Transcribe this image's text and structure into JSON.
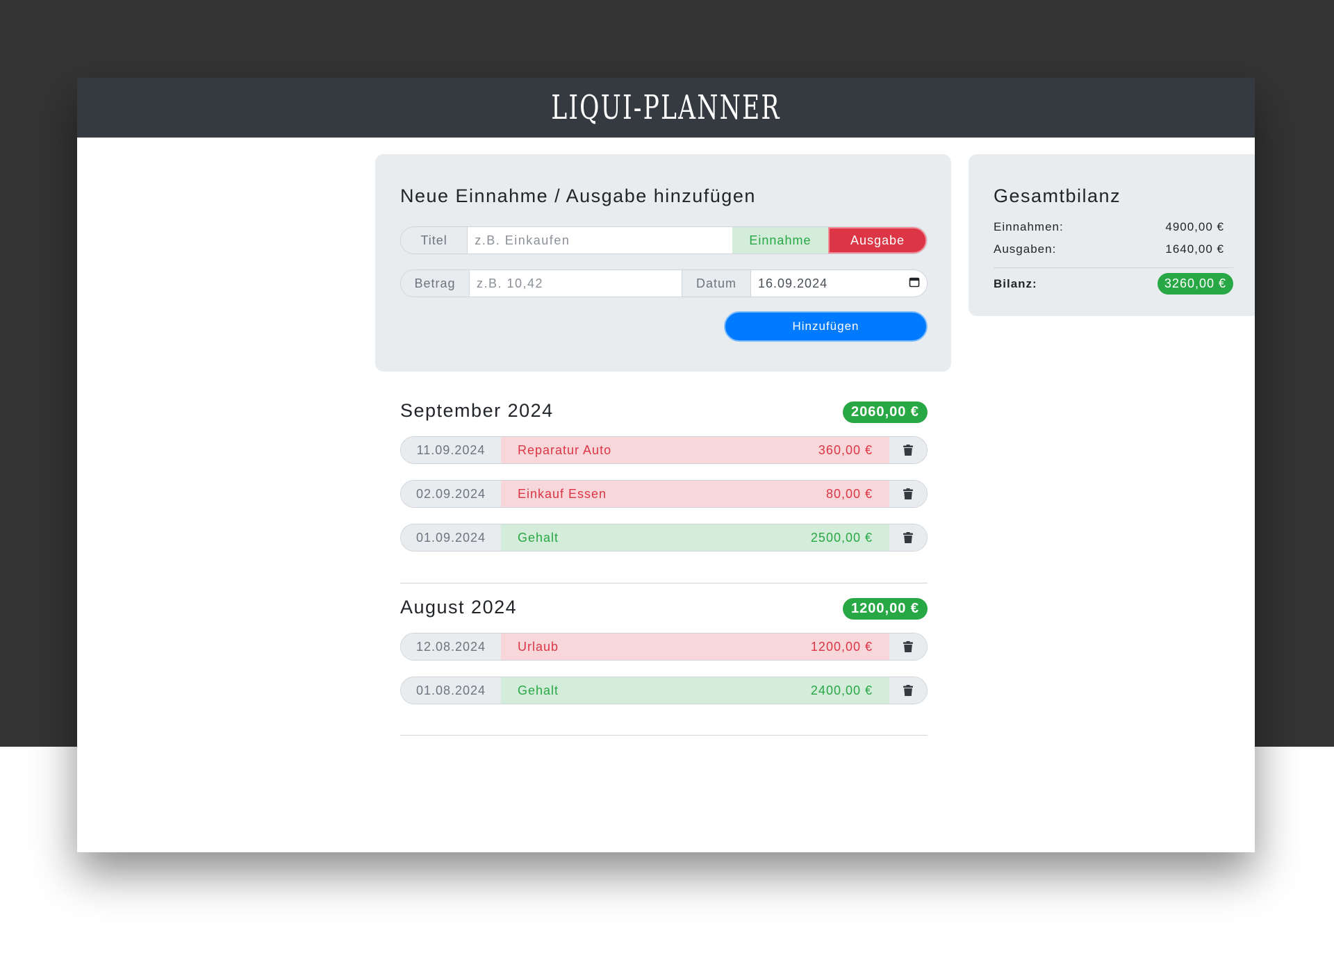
{
  "header": {
    "title": "LIQUI-PLANNER"
  },
  "form": {
    "heading": "Neue Einnahme / Ausgabe hinzufügen",
    "title_label": "Titel",
    "title_placeholder": "z.B. Einkaufen",
    "type_income": "Einnahme",
    "type_expense": "Ausgabe",
    "amount_label": "Betrag",
    "amount_placeholder": "z.B. 10,42",
    "date_label": "Datum",
    "date_value": "16.09.2024",
    "submit_label": "Hinzufügen"
  },
  "balance": {
    "heading": "Gesamtbilanz",
    "income_label": "Einnahmen:",
    "income_value": "4900,00 €",
    "expense_label": "Ausgaben:",
    "expense_value": "1640,00 €",
    "total_label": "Bilanz:",
    "total_value": "3260,00 €"
  },
  "months": [
    {
      "title": "September 2024",
      "total": "2060,00 €",
      "entries": [
        {
          "date": "11.09.2024",
          "title": "Reparatur Auto",
          "amount": "360,00 €",
          "type": "expense"
        },
        {
          "date": "02.09.2024",
          "title": "Einkauf Essen",
          "amount": "80,00 €",
          "type": "expense"
        },
        {
          "date": "01.09.2024",
          "title": "Gehalt",
          "amount": "2500,00 €",
          "type": "income"
        }
      ]
    },
    {
      "title": "August 2024",
      "total": "1200,00 €",
      "entries": [
        {
          "date": "12.08.2024",
          "title": "Urlaub",
          "amount": "1200,00 €",
          "type": "expense"
        },
        {
          "date": "01.08.2024",
          "title": "Gehalt",
          "amount": "2400,00 €",
          "type": "income"
        }
      ]
    }
  ],
  "colors": {
    "header_bg": "#343a40",
    "income": "#28a745",
    "expense": "#dc3545",
    "primary": "#007bff"
  },
  "icons": {
    "delete": "trash-icon",
    "calendar": "calendar-icon"
  }
}
